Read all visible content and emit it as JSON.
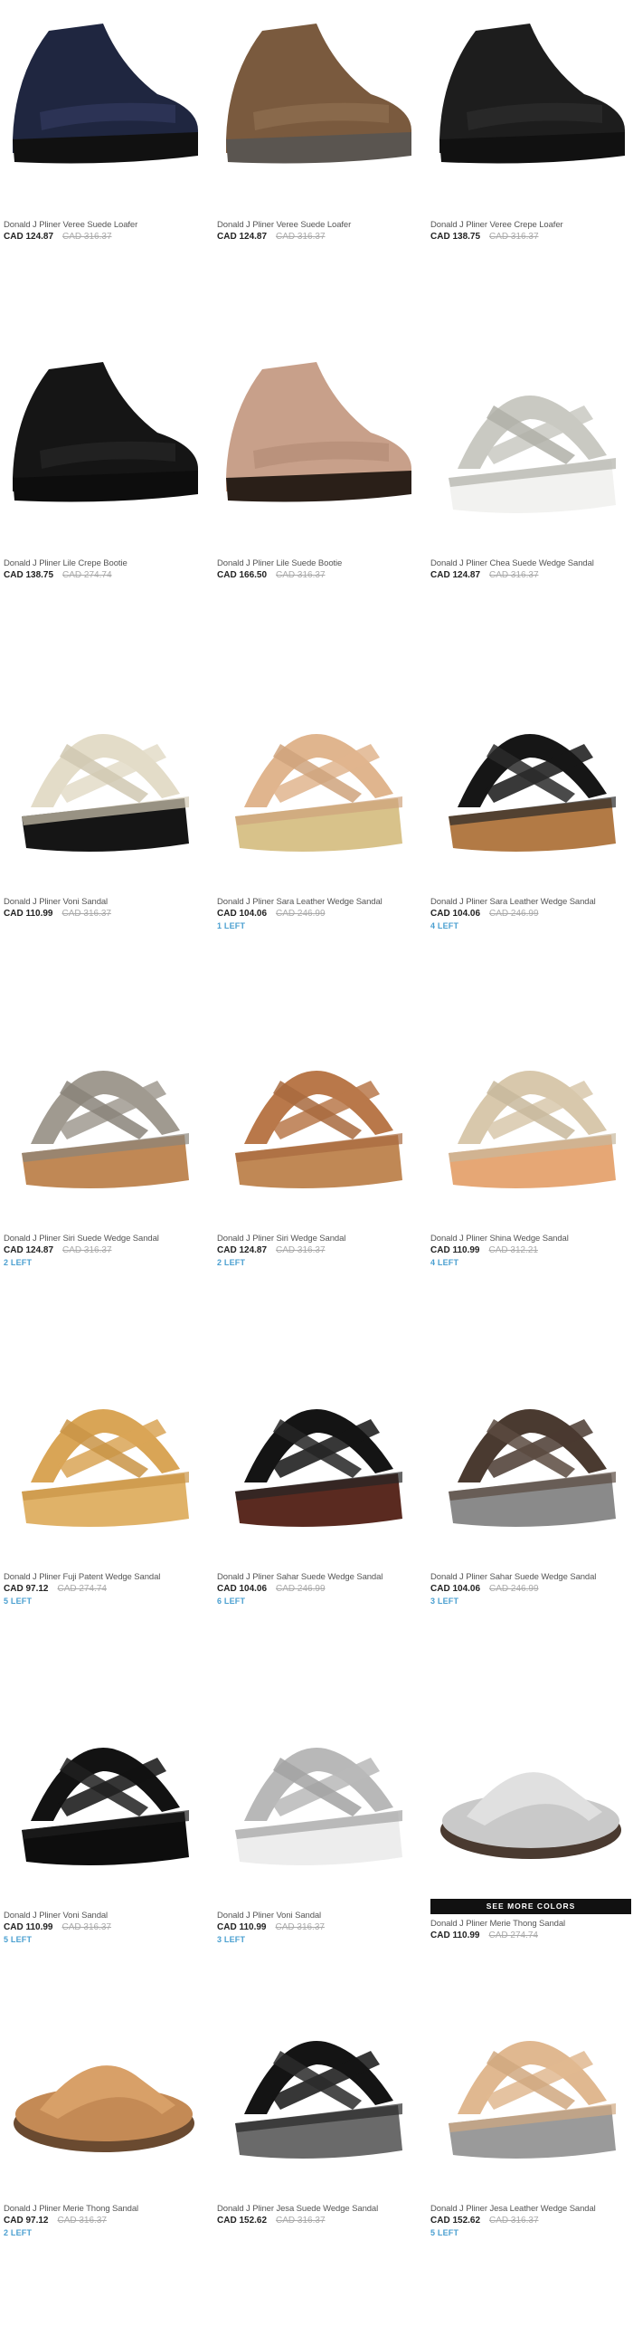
{
  "products": [
    {
      "name": "Donald J Pliner Veree Suede Loafer",
      "price": "CAD 124.87",
      "was": "CAD 316.37",
      "stock": "",
      "more": "",
      "icon": "shoe-icon",
      "colors": {
        "upper": "#1f2640",
        "sole": "#111111",
        "accent": "#2d3558"
      }
    },
    {
      "name": "Donald J Pliner Veree Suede Loafer",
      "price": "CAD 124.87",
      "was": "CAD 316.37",
      "stock": "",
      "more": "",
      "icon": "shoe-icon",
      "colors": {
        "upper": "#7a5a3e",
        "sole": "#5a5550",
        "accent": "#8b6a4c"
      }
    },
    {
      "name": "Donald J Pliner Veree Crepe Loafer",
      "price": "CAD 138.75",
      "was": "CAD 316.37",
      "stock": "",
      "more": "",
      "icon": "shoe-icon",
      "colors": {
        "upper": "#1d1d1d",
        "sole": "#111111",
        "accent": "#2a2a2a"
      }
    },
    {
      "name": "Donald J Pliner Lile Crepe Bootie",
      "price": "CAD 138.75",
      "was": "CAD 274.74",
      "stock": "",
      "more": "",
      "icon": "shoe-icon",
      "colors": {
        "upper": "#151515",
        "sole": "#0d0d0d",
        "accent": "#222222"
      }
    },
    {
      "name": "Donald J Pliner Lile Suede Bootie",
      "price": "CAD 166.50",
      "was": "CAD 316.37",
      "stock": "",
      "more": "",
      "icon": "shoe-icon",
      "colors": {
        "upper": "#c8a08a",
        "sole": "#2a1f18",
        "accent": "#b8907a"
      }
    },
    {
      "name": "Donald J Pliner Chea Suede Wedge Sandal",
      "price": "CAD 124.87",
      "was": "CAD 316.37",
      "stock": "",
      "more": "",
      "icon": "sandal-icon",
      "colors": {
        "upper": "#c9c9c2",
        "sole": "#f2f2f0",
        "accent": "#b0b0a8"
      }
    },
    {
      "name": "Donald J Pliner Voni Sandal",
      "price": "CAD 110.99",
      "was": "CAD 316.37",
      "stock": "",
      "more": "",
      "icon": "sandal-icon",
      "colors": {
        "upper": "#e3dcc8",
        "sole": "#151515",
        "accent": "#d0c8b2"
      }
    },
    {
      "name": "Donald J Pliner Sara Leather Wedge Sandal",
      "price": "CAD 104.06",
      "was": "CAD 246.99",
      "stock": "1 LEFT",
      "more": "",
      "icon": "sandal-icon",
      "colors": {
        "upper": "#e0b58e",
        "sole": "#d8c28a",
        "accent": "#cfa37c"
      }
    },
    {
      "name": "Donald J Pliner Sara Leather Wedge Sandal",
      "price": "CAD 104.06",
      "was": "CAD 246.99",
      "stock": "4 LEFT",
      "more": "",
      "icon": "sandal-icon",
      "colors": {
        "upper": "#161616",
        "sole": "#b27a45",
        "accent": "#2a2a2a"
      }
    },
    {
      "name": "Donald J Pliner Siri Suede Wedge Sandal",
      "price": "CAD 124.87",
      "was": "CAD 316.37",
      "stock": "2 LEFT",
      "more": "",
      "icon": "sandal-icon",
      "colors": {
        "upper": "#a09a90",
        "sole": "#c08855",
        "accent": "#8a847a"
      }
    },
    {
      "name": "Donald J Pliner Siri Wedge Sandal",
      "price": "CAD 124.87",
      "was": "CAD 316.37",
      "stock": "2 LEFT",
      "more": "",
      "icon": "sandal-icon",
      "colors": {
        "upper": "#b9784a",
        "sole": "#c08855",
        "accent": "#a86a3e"
      }
    },
    {
      "name": "Donald J Pliner Shina Wedge Sandal",
      "price": "CAD 110.99",
      "was": "CAD 312.21",
      "stock": "4 LEFT",
      "more": "",
      "icon": "sandal-icon",
      "colors": {
        "upper": "#d8c8ac",
        "sole": "#e6a775",
        "accent": "#c8b89c"
      }
    },
    {
      "name": "Donald J Pliner Fuji Patent Wedge Sandal",
      "price": "CAD 97.12",
      "was": "CAD 274.74",
      "stock": "5 LEFT",
      "more": "",
      "icon": "sandal-icon",
      "colors": {
        "upper": "#d9a556",
        "sole": "#e0b268",
        "accent": "#c99446"
      }
    },
    {
      "name": "Donald J Pliner Sahar Suede Wedge Sandal",
      "price": "CAD 104.06",
      "was": "CAD 246.99",
      "stock": "6 LEFT",
      "more": "",
      "icon": "sandal-icon",
      "colors": {
        "upper": "#141414",
        "sole": "#5a2a20",
        "accent": "#252525"
      }
    },
    {
      "name": "Donald J Pliner Sahar Suede Wedge Sandal",
      "price": "CAD 104.06",
      "was": "CAD 246.99",
      "stock": "3 LEFT",
      "more": "",
      "icon": "sandal-icon",
      "colors": {
        "upper": "#4a3a30",
        "sole": "#8a8a8a",
        "accent": "#5a4a40"
      }
    },
    {
      "name": "Donald J Pliner Voni Sandal",
      "price": "CAD 110.99",
      "was": "CAD 316.37",
      "stock": "5 LEFT",
      "more": "",
      "icon": "sandal-icon",
      "colors": {
        "upper": "#121212",
        "sole": "#0d0d0d",
        "accent": "#202020"
      }
    },
    {
      "name": "Donald J Pliner Voni Sandal",
      "price": "CAD 110.99",
      "was": "CAD 316.37",
      "stock": "3 LEFT",
      "more": "",
      "icon": "sandal-icon",
      "colors": {
        "upper": "#b8b8b8",
        "sole": "#ededed",
        "accent": "#a2a2a2"
      }
    },
    {
      "name": "Donald J Pliner Merie Thong Sandal",
      "price": "CAD 110.99",
      "was": "CAD 274.74",
      "stock": "",
      "more": "SEE MORE COLORS",
      "icon": "thong-sandal-icon",
      "colors": {
        "upper": "#c9c9c9",
        "sole": "#4a3a30",
        "accent": "#e0e0e0"
      }
    },
    {
      "name": "Donald J Pliner Merie Thong Sandal",
      "price": "CAD 97.12",
      "was": "CAD 316.37",
      "stock": "2 LEFT",
      "more": "",
      "icon": "thong-sandal-icon",
      "colors": {
        "upper": "#c48a55",
        "sole": "#6a4a30",
        "accent": "#d8a068"
      }
    },
    {
      "name": "Donald J Pliner Jesa Suede Wedge Sandal",
      "price": "CAD 152.62",
      "was": "CAD 316.37",
      "stock": "",
      "more": "",
      "icon": "sandal-icon",
      "colors": {
        "upper": "#141414",
        "sole": "#6a6a6a",
        "accent": "#2a2a2a"
      }
    },
    {
      "name": "Donald J Pliner Jesa Leather Wedge Sandal",
      "price": "CAD 152.62",
      "was": "CAD 316.37",
      "stock": "5 LEFT",
      "more": "",
      "icon": "sandal-icon",
      "colors": {
        "upper": "#e0b890",
        "sole": "#9a9a9a",
        "accent": "#d0a880"
      }
    }
  ],
  "theme": {
    "stock_color": "#4a9fd0",
    "button_bg": "#111111"
  }
}
